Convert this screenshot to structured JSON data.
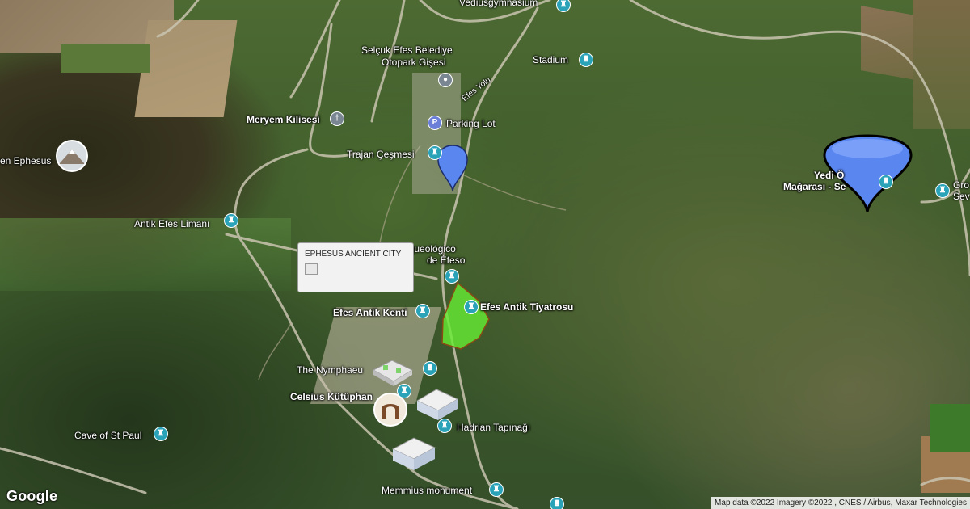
{
  "map": {
    "google_logo": "Google",
    "attribution": "Map data ©2022 Imagery ©2022 , CNES / Airbus, Maxar Technologies"
  },
  "tooltip": {
    "title": "EPHESUS ANCIENT CITY"
  },
  "labels": {
    "vedius": "Vediusgymnasium",
    "selcuk_line1": "Selçuk Efes Belediye",
    "selcuk_line2": "Otopark Gişesi",
    "stadium": "Stadium",
    "efes_yolu": "Efes Yolu",
    "meryem": "Meryem Kilisesi",
    "parking": "Parking Lot",
    "trajan": "Trajan Çeşmesi",
    "ephesus_left": "en Ephesus",
    "yedi_line1": "Yedi Ö",
    "yedi_line2": "Mağarası - Se",
    "gro_line1": "Gro",
    "gro_line2": "Sev",
    "antik_limani": "Antik Efes Limanı",
    "recinto_line1": "Recinto arqueológico",
    "recinto_line2": "de Éfeso",
    "efes_antik_kenti": "Efes Antik Kenti",
    "tiyatrosu": "Efes Antik Tiyatrosu",
    "nymphaeum": "The Nymphaeu",
    "celsius": "Celsius Kütüphan",
    "hadrian": "Hadrian Tapınağı",
    "cave_st_paul": "Cave of St Paul",
    "memmius": "Memmius monument"
  },
  "colors": {
    "poi_teal": "#2aa3b8",
    "highlight_polygon": "#66ee33",
    "marker_blue": "#5a86f0"
  },
  "icons": {
    "poi": "monument-icon",
    "parking": "parking-icon",
    "church": "cross-icon",
    "location": "pin-icon"
  }
}
